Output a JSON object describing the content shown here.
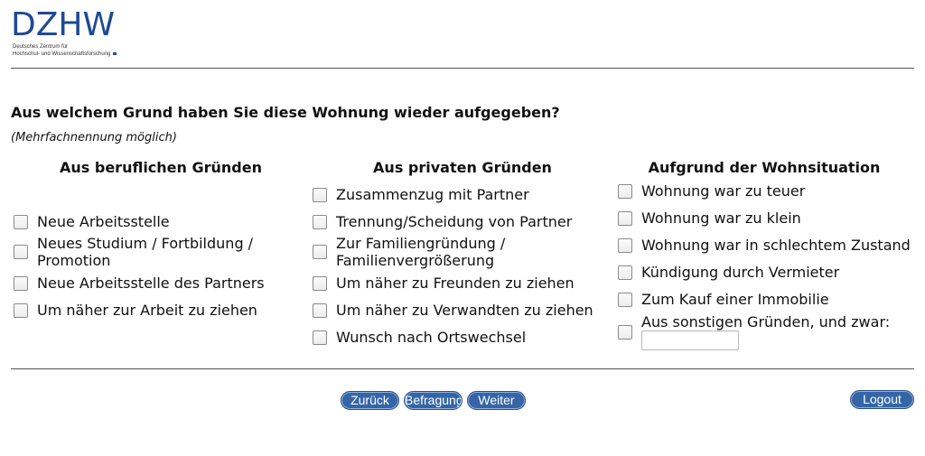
{
  "logo": {
    "word": "DZHW",
    "line1": "Deutsches Zentrum für",
    "line2": "Hochschul- und Wissenschaftsforschung"
  },
  "question": "Aus welchem Grund haben Sie diese Wohnung wieder aufgegeben?",
  "hint": "(Mehrfachnennung möglich)",
  "columns": [
    {
      "heading": "Aus beruflichen Gründen",
      "options": [
        "Neue Arbeitsstelle",
        "Neues Studium / Fortbildung / Promotion",
        "Neue Arbeitsstelle des Partners",
        "Um näher zur Arbeit zu ziehen"
      ]
    },
    {
      "heading": "Aus privaten Gründen",
      "options": [
        "Zusammenzug mit Partner",
        "Trennung/Scheidung von Partner",
        "Zur Familiengründung / Familienvergrößerung",
        "Um näher zu Freunden zu ziehen",
        "Um näher zu Verwandten zu ziehen",
        "Wunsch nach Ortswechsel"
      ]
    },
    {
      "heading": "Aufgrund der Wohnsituation",
      "options": [
        "Wohnung war zu teuer",
        "Wohnung war zu klein",
        "Wohnung war in schlechtem Zustand",
        "Kündigung durch Vermieter",
        "Zum Kauf einer Immobilie",
        "Aus sonstigen Gründen, und zwar:"
      ]
    }
  ],
  "other_text_value": "",
  "buttons": {
    "back": "Zurück",
    "survey": "Befragung",
    "next": "Weiter",
    "logout": "Logout"
  },
  "colors": {
    "brand": "#1f4a93",
    "button": "#3565a6"
  }
}
